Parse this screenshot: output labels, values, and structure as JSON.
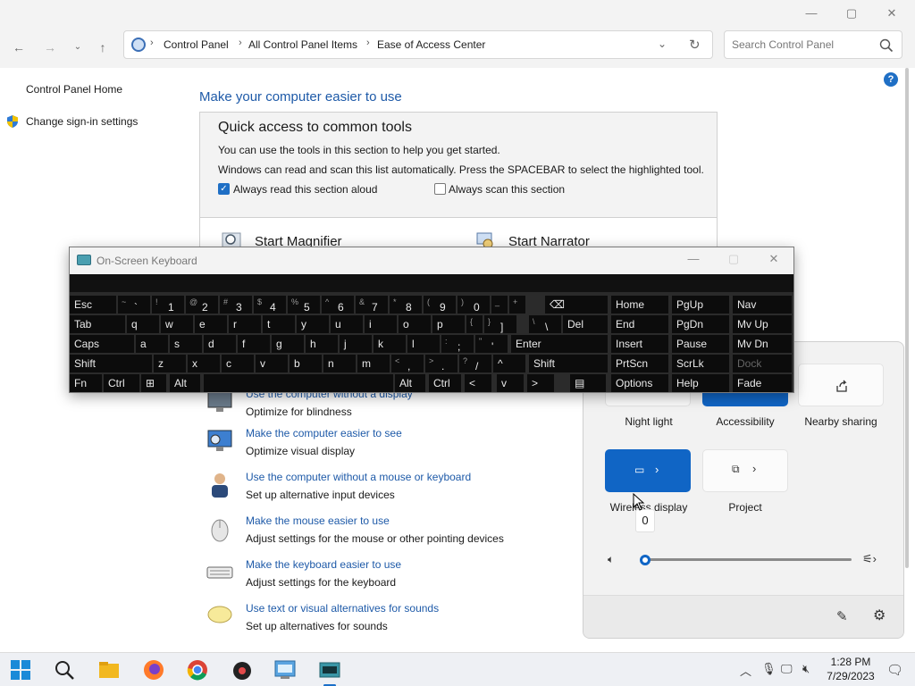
{
  "window": {
    "minimize_glyph": "—",
    "maximize_glyph": "▢",
    "close_glyph": "✕"
  },
  "address": {
    "crumbs": [
      "Control Panel",
      "All Control Panel Items",
      "Ease of Access Center"
    ],
    "search_placeholder": "Search Control Panel"
  },
  "left_pane": {
    "home": "Control Panel Home",
    "signin": "Change sign-in settings"
  },
  "main": {
    "title": "Make your computer easier to use",
    "quick": {
      "heading": "Quick access to common tools",
      "line1": "You can use the tools in this section to help you get started.",
      "line2": "Windows can read and scan this list automatically.  Press the SPACEBAR to select the highlighted tool.",
      "check_read": "Always read this section aloud",
      "check_scan": "Always scan this section",
      "check_read_on": true,
      "check_scan_on": false,
      "tool_magnifier": "Start Magnifier",
      "tool_narrator": "Start Narrator"
    },
    "options": [
      {
        "link": "Use the computer without a display",
        "desc": "Optimize for blindness"
      },
      {
        "link": "Make the computer easier to see",
        "desc": "Optimize visual display"
      },
      {
        "link": "Use the computer without a mouse or keyboard",
        "desc": "Set up alternative input devices"
      },
      {
        "link": "Make the mouse easier to use",
        "desc": "Adjust settings for the mouse or other pointing devices"
      },
      {
        "link": "Make the keyboard easier to use",
        "desc": "Adjust settings for the keyboard"
      },
      {
        "link": "Use text or visual alternatives for sounds",
        "desc": "Set up alternatives for sounds"
      }
    ]
  },
  "quick_settings": {
    "tiles": {
      "night_light": "Night light",
      "accessibility": "Accessibility",
      "nearby_sharing": "Nearby sharing",
      "wireless_display": "Wireless display",
      "project": "Project"
    },
    "volume_value": "0",
    "volume_level": 0
  },
  "osk": {
    "title": "On-Screen Keyboard",
    "rows": [
      [
        "Esc",
        "~|`",
        "!|1",
        "@|2",
        "#|3",
        "$|4",
        "%|5",
        "^|6",
        "&|7",
        "*|8",
        "(|9",
        ")|0",
        "_|-",
        "+|=",
        "⌫"
      ],
      [
        "Tab",
        "q",
        "w",
        "e",
        "r",
        "t",
        "y",
        "u",
        "i",
        "o",
        "p",
        "{|[",
        "}|]",
        "\\|\\",
        "Del"
      ],
      [
        "Caps",
        "a",
        "s",
        "d",
        "f",
        "g",
        "h",
        "j",
        "k",
        "l",
        ":|;",
        "\"|'",
        "Enter"
      ],
      [
        "Shift",
        "z",
        "x",
        "c",
        "v",
        "b",
        "n",
        "m",
        "<|,",
        ">|.",
        "?|/",
        "^",
        "Shift"
      ],
      [
        "Fn",
        "Ctrl",
        "⊞",
        "Alt",
        "",
        "Alt",
        "Ctrl",
        "<",
        "v",
        ">",
        "▤"
      ]
    ],
    "nav_rows": [
      [
        "Home",
        "PgUp",
        "Nav"
      ],
      [
        "End",
        "PgDn",
        "Mv Up"
      ],
      [
        "Insert",
        "Pause",
        "Mv Dn"
      ],
      [
        "PrtScn",
        "ScrLk",
        "Dock"
      ],
      [
        "Options",
        "Help",
        "Fade"
      ]
    ]
  },
  "taskbar": {
    "time": "1:28 PM",
    "date": "7/29/2023"
  }
}
